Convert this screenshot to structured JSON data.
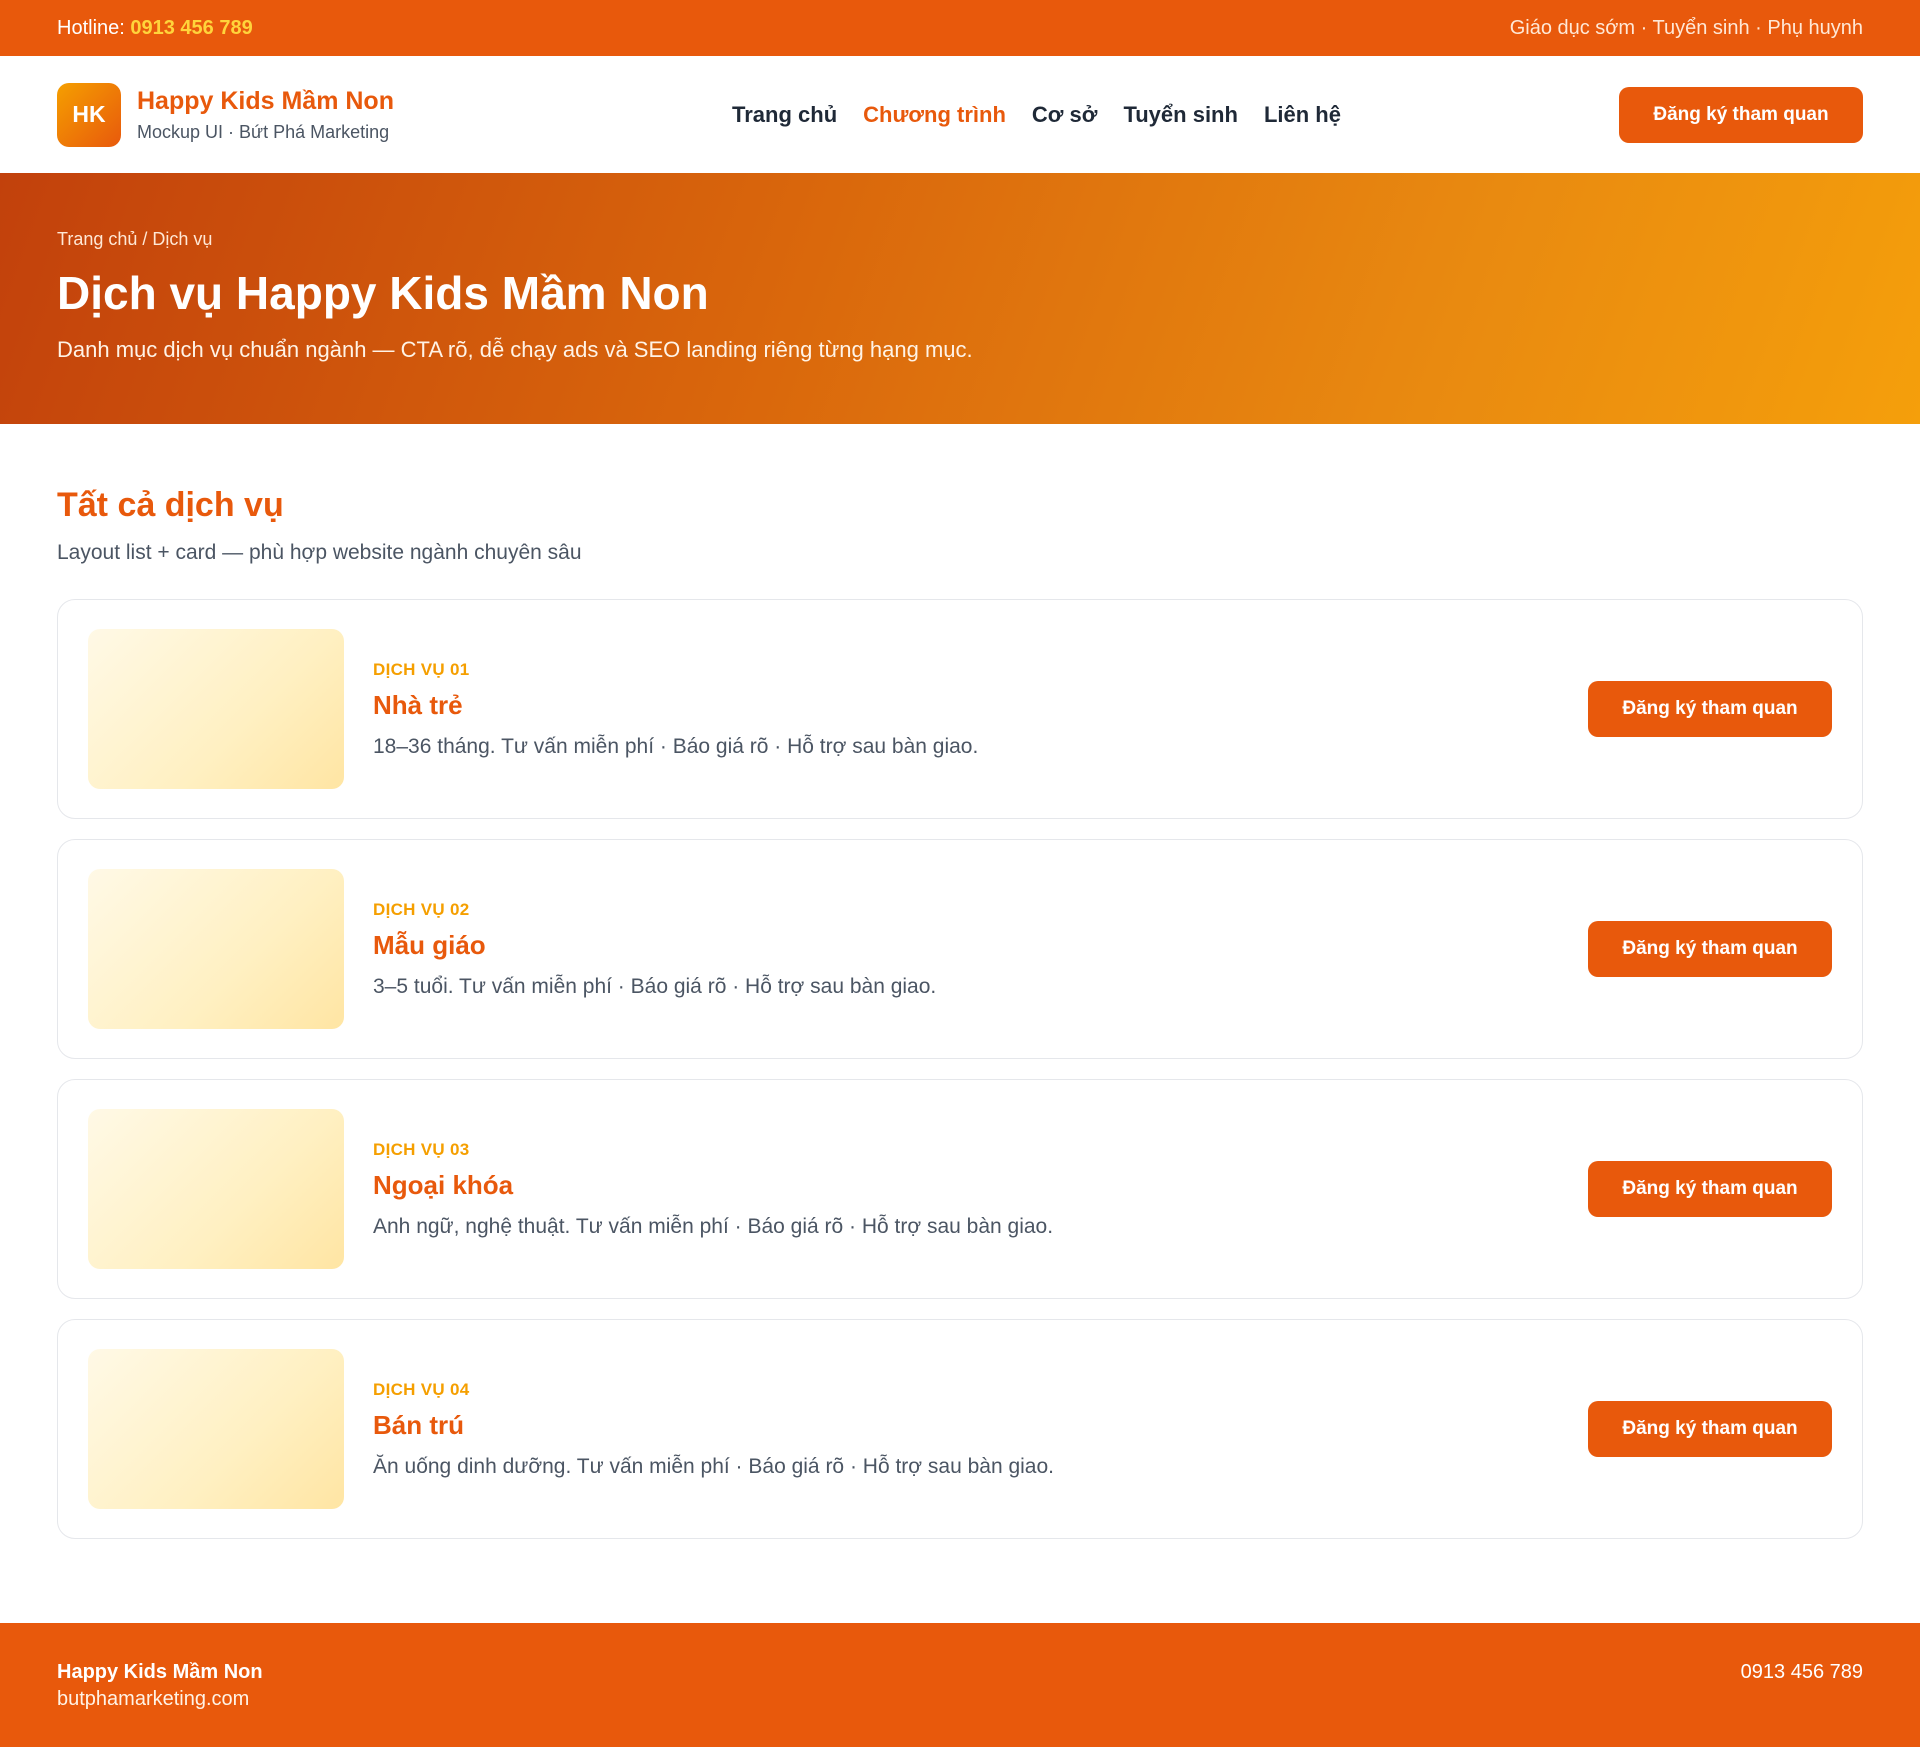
{
  "topbar": {
    "hotline_label": "Hotline: ",
    "hotline_number": "0913 456 789",
    "tagline": "Giáo dục sớm · Tuyển sinh · Phụ huynh"
  },
  "header": {
    "logo_text": "HK",
    "brand_name": "Happy Kids Mầm Non",
    "brand_sub": "Mockup UI · Bứt Phá Marketing",
    "nav": [
      "Trang chủ",
      "Chương trình",
      "Cơ sở",
      "Tuyển sinh",
      "Liên hệ"
    ],
    "active_nav": "Chương trình",
    "cta": "Đăng ký tham quan"
  },
  "hero": {
    "breadcrumb": "Trang chủ / Dịch vụ",
    "title": "Dịch vụ Happy Kids Mầm Non",
    "lead": "Danh mục dịch vụ chuẩn ngành — CTA rõ, dễ chạy ads và SEO landing riêng từng hạng mục."
  },
  "services": {
    "heading": "Tất cả dịch vụ",
    "subheading": "Layout list + card — phù hợp website ngành chuyên sâu",
    "items": [
      {
        "eyebrow": "DỊCH VỤ 01",
        "title": "Nhà trẻ",
        "desc": "18–36 tháng. Tư vấn miễn phí · Báo giá rõ · Hỗ trợ sau bàn giao.",
        "cta": "Đăng ký tham quan"
      },
      {
        "eyebrow": "DỊCH VỤ 02",
        "title": "Mẫu giáo",
        "desc": "3–5 tuổi. Tư vấn miễn phí · Báo giá rõ · Hỗ trợ sau bàn giao.",
        "cta": "Đăng ký tham quan"
      },
      {
        "eyebrow": "DỊCH VỤ 03",
        "title": "Ngoại khóa",
        "desc": "Anh ngữ, nghệ thuật. Tư vấn miễn phí · Báo giá rõ · Hỗ trợ sau bàn giao.",
        "cta": "Đăng ký tham quan"
      },
      {
        "eyebrow": "DỊCH VỤ 04",
        "title": "Bán trú",
        "desc": "Ăn uống dinh dưỡng. Tư vấn miễn phí · Báo giá rõ · Hỗ trợ sau bàn giao.",
        "cta": "Đăng ký tham quan"
      }
    ]
  },
  "footer": {
    "name": "Happy Kids Mầm Non",
    "site": "butphamarketing.com",
    "phone": "0913 456 789"
  },
  "colors": {
    "brand_orange": "#e8590c",
    "accent_yellow": "#ffd43b",
    "eyebrow_amber": "#f59f00"
  }
}
